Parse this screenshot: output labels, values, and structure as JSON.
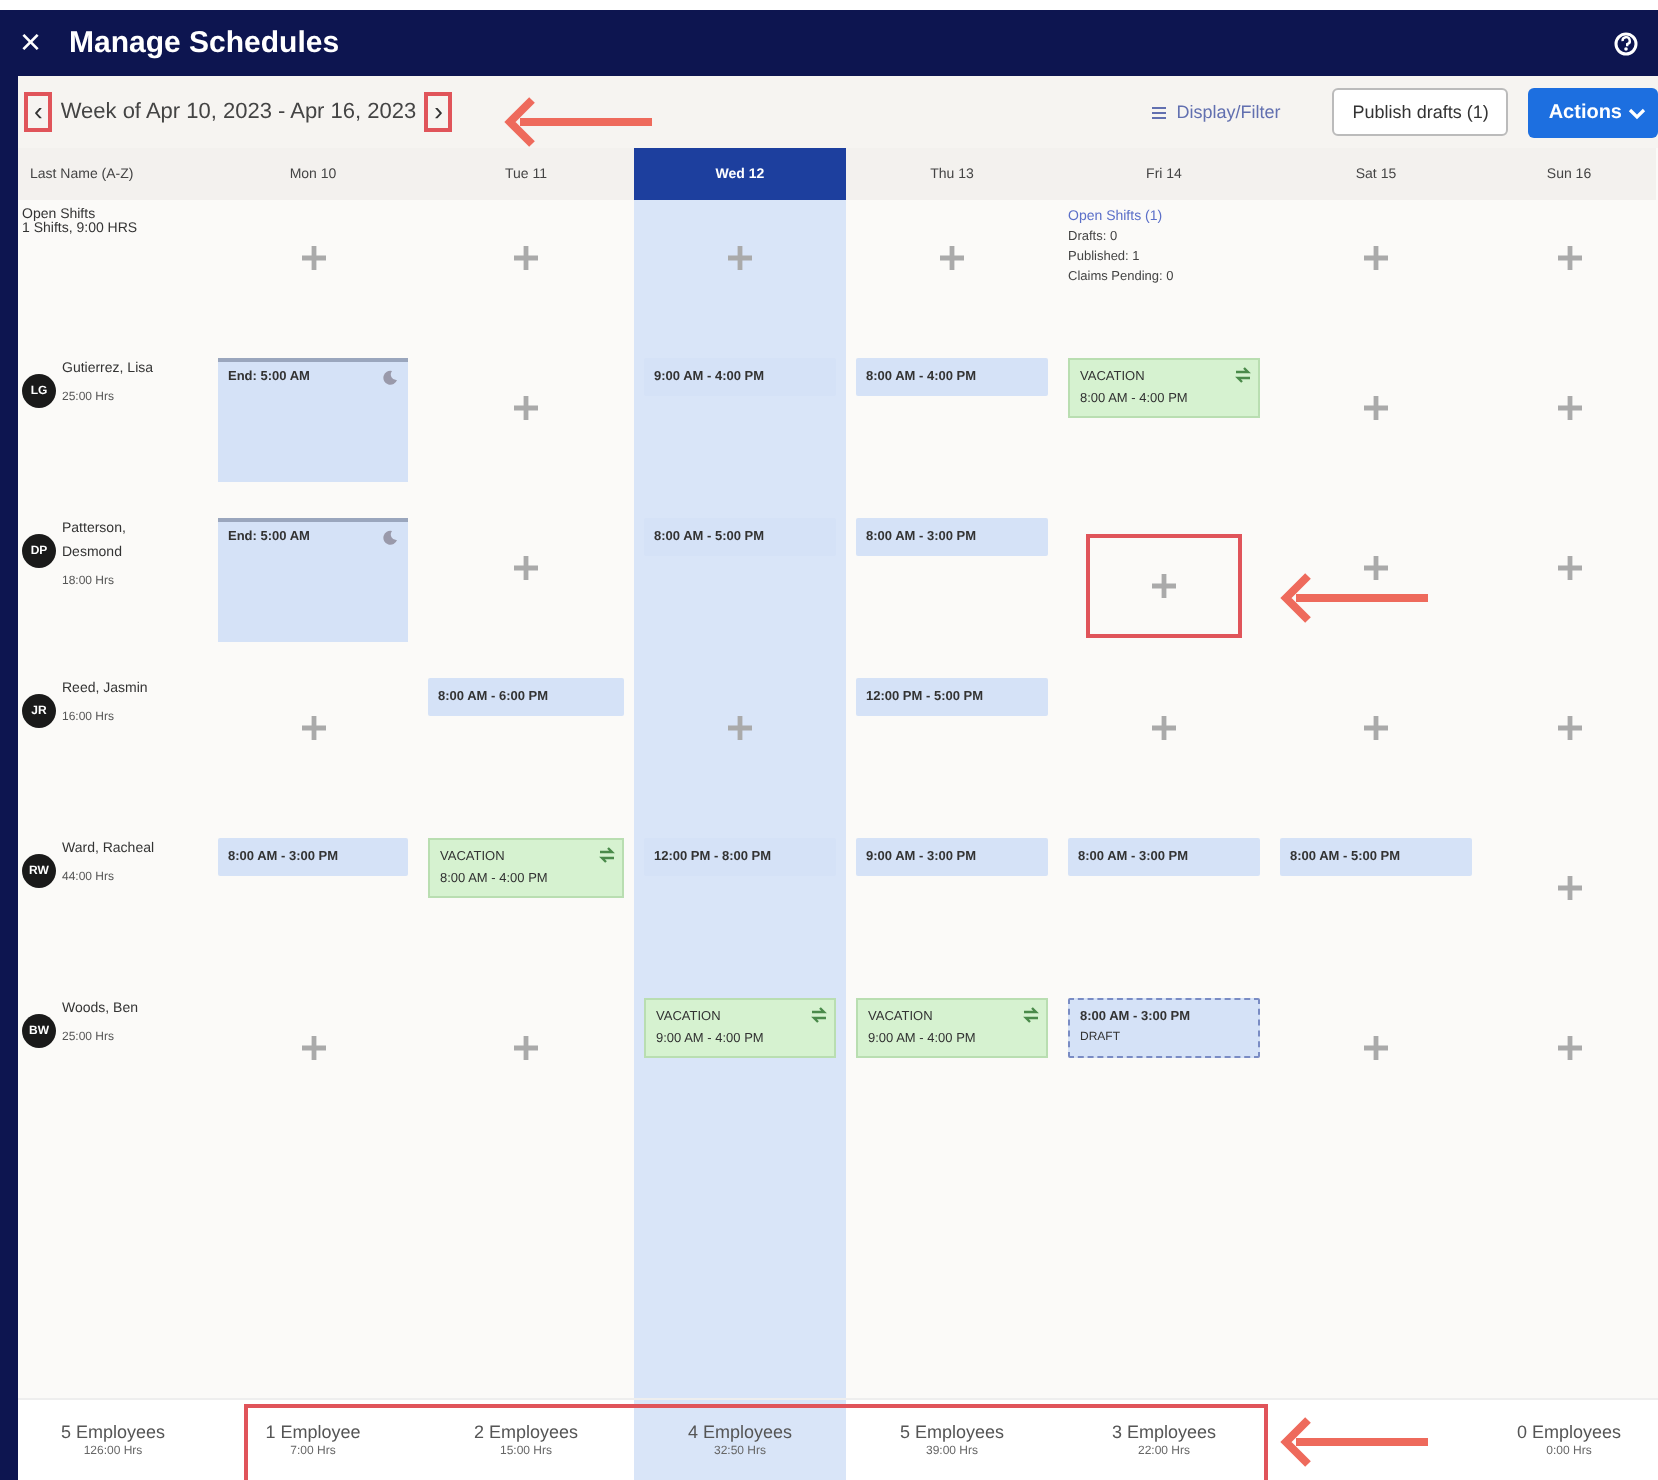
{
  "window": {
    "title": "Manage Schedules",
    "close": "×"
  },
  "toolbar": {
    "prev": {
      "label": "‹",
      "highlighted": true
    },
    "week": "Week of Apr 10, 2023 - Apr 16, 2023",
    "next": {
      "label": "›",
      "highlighted": true
    },
    "display_filter": "Display/Filter",
    "publish": "Publish drafts (1)",
    "actions": "Actions"
  },
  "columns": [
    {
      "label": "Last Name (A-Z)",
      "selected": false,
      "total": {
        "count": "5 Employees",
        "hours": "126:00 Hrs"
      }
    },
    {
      "label": "Mon 10",
      "selected": false,
      "total": {
        "count": "1 Employee",
        "hours": "7:00 Hrs"
      }
    },
    {
      "label": "Tue 11",
      "selected": false,
      "total": {
        "count": "2 Employees",
        "hours": "15:00 Hrs"
      }
    },
    {
      "label": "Wed 12",
      "selected": true,
      "total": {
        "count": "4 Employees",
        "hours": "32:50 Hrs"
      }
    },
    {
      "label": "Thu 13",
      "selected": false,
      "total": {
        "count": "5 Employees",
        "hours": "39:00 Hrs"
      }
    },
    {
      "label": "Fri 14",
      "selected": false,
      "total": {
        "count": "3 Employees",
        "hours": "22:00 Hrs"
      }
    },
    {
      "label": "Sat 15",
      "selected": false
    },
    {
      "label": "Sun 16",
      "selected": false,
      "total": {
        "count": "0 Employees",
        "hours": "0:00 Hrs"
      }
    }
  ],
  "open_shifts": {
    "title": "Open Shifts",
    "summary": "1 Shifts, 9:00 HRS",
    "cells": [
      {
        "kind": "add"
      },
      {
        "kind": "add"
      },
      {
        "kind": "add"
      },
      {
        "kind": "add"
      },
      {
        "kind": "open",
        "title": "Open Shifts (1)",
        "lines": [
          "Drafts: 0",
          "Published: 1",
          "Claims Pending: 0"
        ]
      },
      {
        "kind": "add"
      },
      {
        "kind": "add"
      }
    ]
  },
  "employees": [
    {
      "initials": "LG",
      "name": "Gutierrez, Lisa",
      "hours": "25:00 Hrs",
      "cells": [
        {
          "kind": "overnight",
          "text": "End: 5:00 AM"
        },
        {
          "kind": "add"
        },
        {
          "kind": "shift",
          "text": "9:00 AM - 4:00 PM"
        },
        {
          "kind": "shift",
          "text": "8:00 AM - 4:00 PM"
        },
        {
          "kind": "vacation",
          "label": "VACATION",
          "text": "8:00 AM - 4:00 PM"
        },
        {
          "kind": "add"
        },
        {
          "kind": "add"
        }
      ]
    },
    {
      "initials": "DP",
      "name": "Patterson, Desmond",
      "hours": "18:00 Hrs",
      "cells": [
        {
          "kind": "overnight",
          "text": "End: 5:00 AM"
        },
        {
          "kind": "add"
        },
        {
          "kind": "shift",
          "text": "8:00 AM - 5:00 PM"
        },
        {
          "kind": "shift",
          "text": "8:00 AM - 3:00 PM"
        },
        {
          "kind": "add",
          "highlighted": true
        },
        {
          "kind": "add"
        },
        {
          "kind": "add"
        }
      ]
    },
    {
      "initials": "JR",
      "name": "Reed, Jasmin",
      "hours": "16:00 Hrs",
      "cells": [
        {
          "kind": "add"
        },
        {
          "kind": "shift",
          "text": "8:00 AM - 6:00 PM"
        },
        {
          "kind": "add"
        },
        {
          "kind": "shift",
          "text": "12:00 PM - 5:00 PM"
        },
        {
          "kind": "add"
        },
        {
          "kind": "add"
        },
        {
          "kind": "add"
        }
      ]
    },
    {
      "initials": "RW",
      "name": "Ward, Racheal",
      "hours": "44:00 Hrs",
      "cells": [
        {
          "kind": "shift",
          "text": "8:00 AM - 3:00 PM"
        },
        {
          "kind": "vacation",
          "label": "VACATION",
          "text": "8:00 AM - 4:00 PM"
        },
        {
          "kind": "shift",
          "text": "12:00 PM - 8:00 PM"
        },
        {
          "kind": "shift",
          "text": "9:00 AM - 3:00 PM"
        },
        {
          "kind": "shift",
          "text": "8:00 AM - 3:00 PM"
        },
        {
          "kind": "shift",
          "text": "8:00 AM - 5:00 PM"
        },
        {
          "kind": "add"
        }
      ]
    },
    {
      "initials": "BW",
      "name": "Woods, Ben",
      "hours": "25:00 Hrs",
      "cells": [
        {
          "kind": "add"
        },
        {
          "kind": "add"
        },
        {
          "kind": "vacation",
          "label": "VACATION",
          "text": "9:00 AM - 4:00 PM"
        },
        {
          "kind": "vacation",
          "label": "VACATION",
          "text": "9:00 AM - 4:00 PM"
        },
        {
          "kind": "draft",
          "text": "8:00 AM - 3:00 PM",
          "label": "DRAFT"
        },
        {
          "kind": "add"
        },
        {
          "kind": "add"
        }
      ]
    }
  ]
}
